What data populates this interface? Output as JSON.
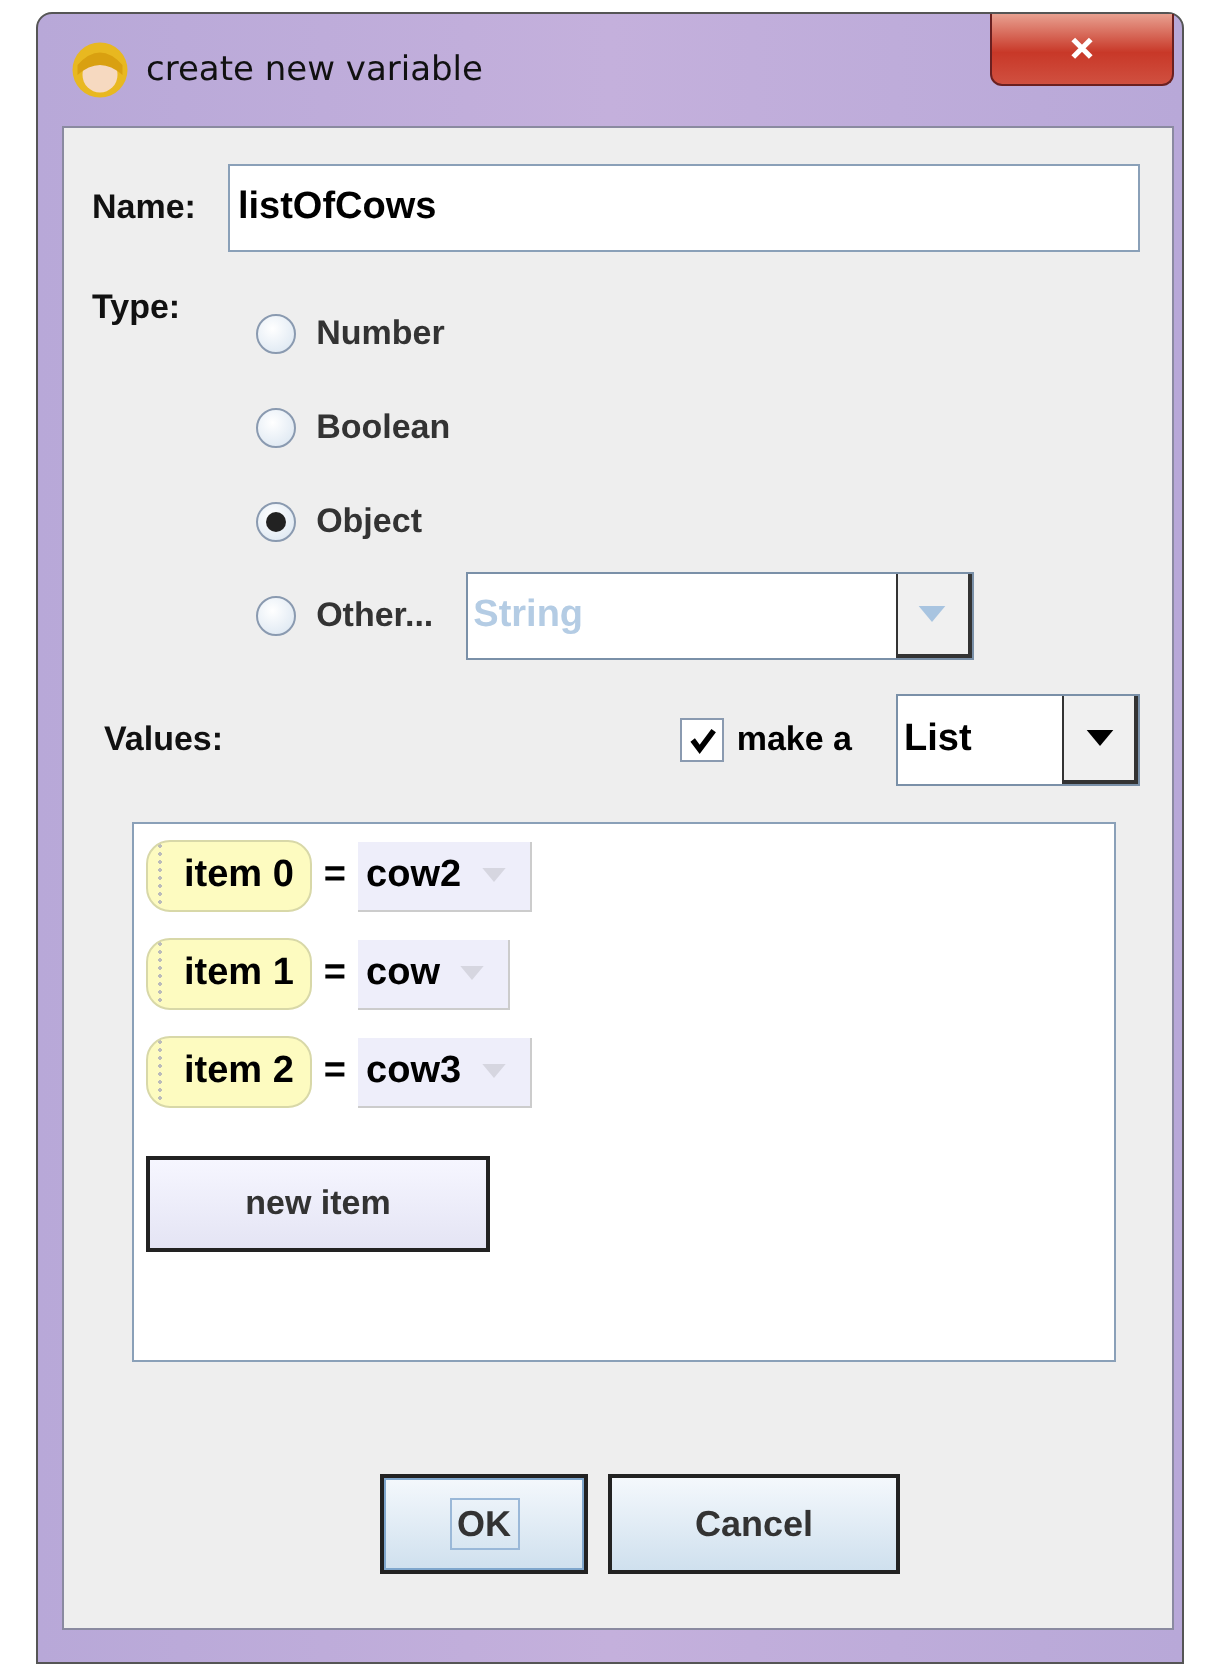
{
  "window": {
    "title": "create new variable"
  },
  "name": {
    "label": "Name:",
    "value": "listOfCows"
  },
  "type": {
    "label": "Type:",
    "options": [
      {
        "label": "Number",
        "selected": false
      },
      {
        "label": "Boolean",
        "selected": false
      },
      {
        "label": "Object",
        "selected": true
      },
      {
        "label": "Other...",
        "selected": false
      }
    ],
    "other_combo": {
      "value": "String",
      "disabled": true
    }
  },
  "values": {
    "label": "Values:",
    "make_a": {
      "label": "make a",
      "checked": true
    },
    "collection_combo": {
      "value": "List"
    },
    "items": [
      {
        "name": "item 0",
        "equals": "=",
        "value": "cow2"
      },
      {
        "name": "item 1",
        "equals": "=",
        "value": "cow"
      },
      {
        "name": "item 2",
        "equals": "=",
        "value": "cow3"
      }
    ],
    "new_item_button": "new item"
  },
  "buttons": [
    {
      "label": "OK",
      "focused": true
    },
    {
      "label": "Cancel",
      "focused": false
    }
  ]
}
